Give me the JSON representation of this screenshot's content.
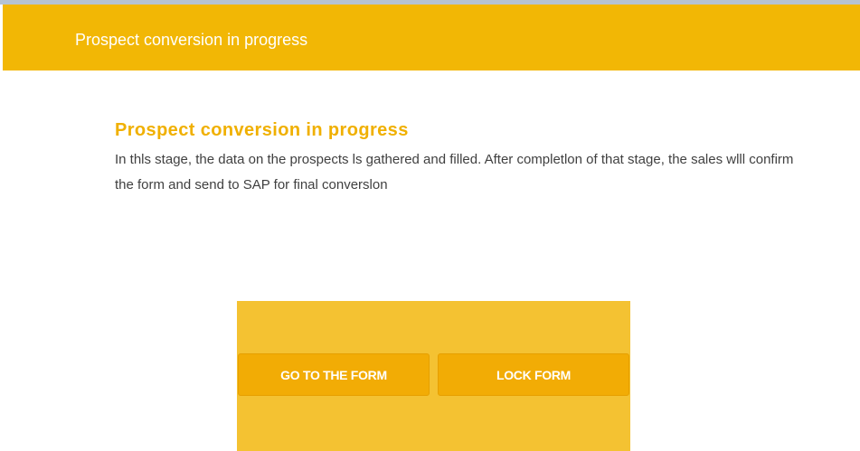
{
  "header": {
    "title": "Prospect conversion in progress",
    "background_color": "#f2b705"
  },
  "section": {
    "heading": "Prospect conversion in progress",
    "description": "In thls stage, the data on the prospects ls gathered and filled. After completlon of that stage, the sales wlll confirm the form and send to SAP for final converslon",
    "heading_color": "#f0b000"
  },
  "actions": {
    "panel_color": "#f4c232",
    "button_color": "#f2ac05",
    "go_to_form_label": "GO TO THE FORM",
    "lock_form_label": "LOCK FORM"
  }
}
